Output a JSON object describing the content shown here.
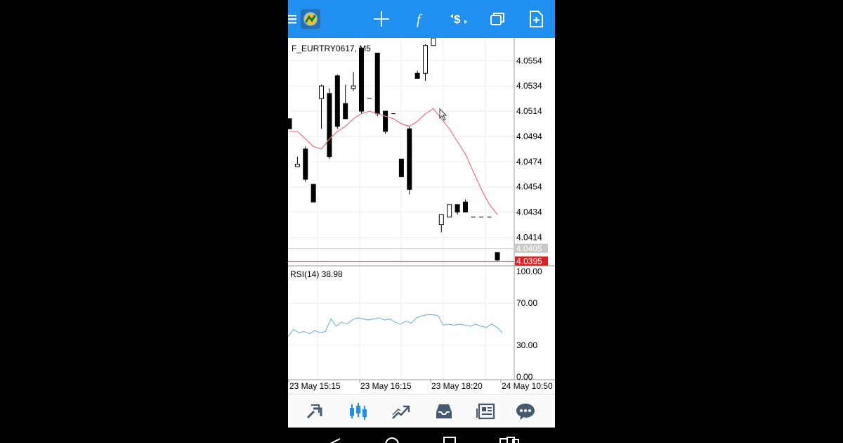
{
  "top_toolbar": {
    "icons": [
      "menu-icon",
      "metatrader-logo-icon",
      "crosshair-icon",
      "indicators-icon",
      "symbols-icon",
      "windows-icon",
      "new-order-icon"
    ]
  },
  "chart": {
    "symbol_label": "F_EURTRY0617, M5",
    "rsi_label": "RSI(14) 38.98",
    "current_price": "4.0395",
    "bid_ask_price": "4.0405",
    "price_ticks": [
      "4.0554",
      "4.0534",
      "4.0514",
      "4.0494",
      "4.0474",
      "4.0454",
      "4.0434",
      "4.0414"
    ],
    "rsi_ticks": [
      "100.00",
      "70.00",
      "30.00",
      "0.00"
    ],
    "time_ticks": [
      "23 May 15:15",
      "23 May 16:15",
      "23 May 18:20",
      "24 May 10:50"
    ],
    "colors": {
      "ma_line": "#e8737a",
      "rsi_line": "#7fb6e0",
      "price_tag_bg": "#e02020",
      "bid_tag_bg": "#c8c8c8"
    }
  },
  "chart_data": {
    "type": "line",
    "candles": [
      {
        "o": 4.0508,
        "c": 4.05,
        "h": 4.0508,
        "l": 4.05
      },
      {
        "o": 4.047,
        "c": 4.0472,
        "h": 4.0478,
        "l": 4.047
      },
      {
        "o": 4.0484,
        "c": 4.046,
        "h": 4.0486,
        "l": 4.0458
      },
      {
        "o": 4.0456,
        "c": 4.0442,
        "h": 4.0456,
        "l": 4.0442
      },
      {
        "o": 4.0524,
        "c": 4.0534,
        "h": 4.0535,
        "l": 4.05
      },
      {
        "o": 4.0528,
        "c": 4.0478,
        "h": 4.0532,
        "l": 4.0476
      },
      {
        "o": 4.0542,
        "c": 4.0502,
        "h": 4.0543,
        "l": 4.05
      },
      {
        "o": 4.052,
        "c": 4.0508,
        "h": 4.0535,
        "l": 4.0508
      },
      {
        "o": 4.0532,
        "c": 4.0534,
        "h": 4.0545,
        "l": 4.053
      },
      {
        "o": 4.0564,
        "c": 4.0514,
        "h": 4.0565,
        "l": 4.0512
      },
      {
        "o": 4.0524,
        "c": 4.0524,
        "h": 4.0524,
        "l": 4.0524
      },
      {
        "o": 4.056,
        "c": 4.0512,
        "h": 4.056,
        "l": 4.051
      },
      {
        "o": 4.0514,
        "c": 4.0498,
        "h": 4.0514,
        "l": 4.0496
      },
      {
        "o": 4.0512,
        "c": 4.0512,
        "h": 4.0512,
        "l": 4.0512
      },
      {
        "o": 4.0476,
        "c": 4.0462,
        "h": 4.0476,
        "l": 4.0462
      },
      {
        "o": 4.05,
        "c": 4.0452,
        "h": 4.0502,
        "l": 4.0448
      },
      {
        "o": 4.0544,
        "c": 4.054,
        "h": 4.0546,
        "l": 4.054
      },
      {
        "o": 4.0544,
        "c": 4.0566,
        "h": 4.0567,
        "l": 4.0538
      },
      {
        "o": 4.0566,
        "c": 4.0572,
        "h": 4.0572,
        "l": 4.0566
      },
      {
        "o": 4.0424,
        "c": 4.0432,
        "h": 4.0432,
        "l": 4.0418
      },
      {
        "o": 4.043,
        "c": 4.044,
        "h": 4.044,
        "l": 4.043
      },
      {
        "o": 4.044,
        "c": 4.0434,
        "h": 4.044,
        "l": 4.0432
      },
      {
        "o": 4.0442,
        "c": 4.0434,
        "h": 4.0444,
        "l": 4.0434
      },
      {
        "o": 4.043,
        "c": 4.043,
        "h": 4.043,
        "l": 4.043
      },
      {
        "o": 4.043,
        "c": 4.043,
        "h": 4.043,
        "l": 4.043
      },
      {
        "o": 4.043,
        "c": 4.043,
        "h": 4.043,
        "l": 4.043
      },
      {
        "o": 4.0402,
        "c": 4.0396,
        "h": 4.0402,
        "l": 4.0395
      }
    ],
    "moving_average": [
      4.0498,
      4.0498,
      4.0492,
      4.0486,
      4.0484,
      4.0492,
      4.0498,
      4.0502,
      4.0508,
      4.0512,
      4.0514,
      4.0512,
      4.051,
      4.0508,
      4.0504,
      4.0502,
      4.0506,
      4.0512,
      4.0516,
      4.0508,
      4.05,
      4.049,
      4.048,
      4.0466,
      4.0452,
      4.044,
      4.0432
    ],
    "rsi": [
      38,
      45,
      42,
      43,
      41,
      44,
      42,
      43,
      55,
      48,
      52,
      50,
      54,
      56,
      55,
      54,
      55,
      56,
      54,
      55,
      52,
      50,
      53,
      51,
      56,
      58,
      59,
      59,
      58,
      49,
      50,
      49,
      50,
      49,
      48,
      50,
      48,
      47,
      50,
      47,
      42
    ],
    "ylim": [
      4.0392,
      4.0572
    ],
    "rsi_ylim": [
      0,
      100
    ],
    "rsi_levels": [
      70,
      30
    ]
  },
  "bottom_nav": {
    "items": [
      {
        "icon": "quotes-icon",
        "active": false
      },
      {
        "icon": "chart-icon",
        "active": true
      },
      {
        "icon": "trade-icon",
        "active": false
      },
      {
        "icon": "history-icon",
        "active": false
      },
      {
        "icon": "news-icon",
        "active": false
      },
      {
        "icon": "chat-icon",
        "active": false
      }
    ]
  },
  "system_nav": {
    "icons": [
      "back-icon",
      "home-icon",
      "recents-icon",
      "extra-icon"
    ]
  }
}
